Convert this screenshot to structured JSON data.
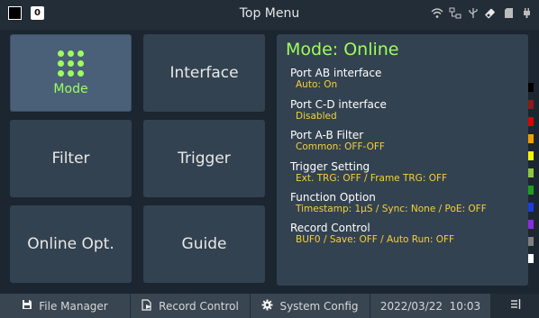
{
  "header": {
    "indicator_badge": "0",
    "title": "Top Menu",
    "status_icons": [
      "wifi-icon",
      "network-icon",
      "usb-icon",
      "usb-drive-icon",
      "sd-card-icon",
      "power-plug-icon"
    ]
  },
  "menu": {
    "mode": "Mode",
    "interface": "Interface",
    "filter": "Filter",
    "trigger": "Trigger",
    "online_opt": "Online Opt.",
    "guide": "Guide"
  },
  "panel": {
    "title": "Mode: Online",
    "items": [
      {
        "label": "Port AB interface",
        "value": "Auto: On"
      },
      {
        "label": "Port C-D interface",
        "value": "Disabled"
      },
      {
        "label": "Port A-B Filter",
        "value": "Common: OFF-OFF"
      },
      {
        "label": "Trigger Setting",
        "value": "Ext. TRG: OFF / Frame TRG: OFF"
      },
      {
        "label": "Function Option",
        "value": "Timestamp: 1μS / Sync: None / PoE: OFF"
      },
      {
        "label": "Record Control",
        "value": "BUF0 / Save: OFF / Auto Run: OFF"
      }
    ]
  },
  "swatch_colors": [
    "#000000",
    "#8b1a1a",
    "#e00000",
    "#f59c00",
    "#f5f500",
    "#8ec63f",
    "#1e9e1e",
    "#1c3ce0",
    "#8a2be2",
    "#7f7f7f",
    "#ffffff"
  ],
  "colors": {
    "accent_green": "#9dff5c",
    "value_yellow": "#f5d03a"
  },
  "footer": {
    "file_manager": "File Manager",
    "record_control": "Record Control",
    "system_config": "System Config",
    "datetime": "2022/03/22  10:03"
  }
}
